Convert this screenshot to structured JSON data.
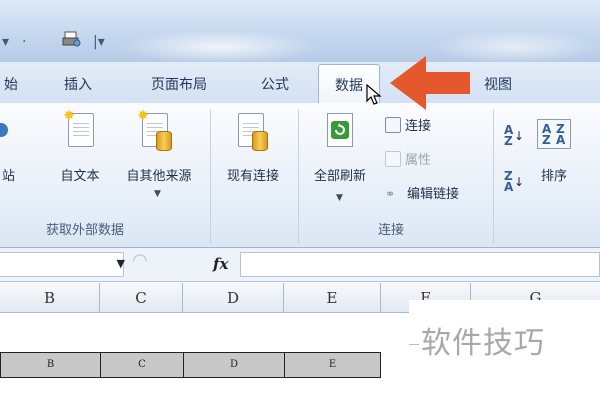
{
  "tabs": {
    "partial": "始",
    "insert": "插入",
    "page_layout": "页面布局",
    "formulas": "公式",
    "data": "数据",
    "view": "视图"
  },
  "ribbon": {
    "get_external": {
      "from_web_partial": "站",
      "from_text": "自文本",
      "from_other": "自其他来源",
      "existing_connections": "现有连接",
      "group_label": "获取外部数据"
    },
    "connections": {
      "refresh_all": "全部刷新",
      "connections": "连接",
      "properties": "属性",
      "edit_links": "编辑链接",
      "group_label": "连接"
    },
    "sort": {
      "sort_partial": "排序"
    }
  },
  "formula_bar": {
    "fx_label": "fx"
  },
  "columns": [
    "B",
    "C",
    "D",
    "E",
    "F",
    "G"
  ],
  "printed_row": [
    "B",
    "C",
    "D",
    "E"
  ],
  "watermark": "软件技巧",
  "colors": {
    "arrow": "#e4582e",
    "active_tab": "#ffffff",
    "ribbon_bg": "#e6eef8"
  }
}
